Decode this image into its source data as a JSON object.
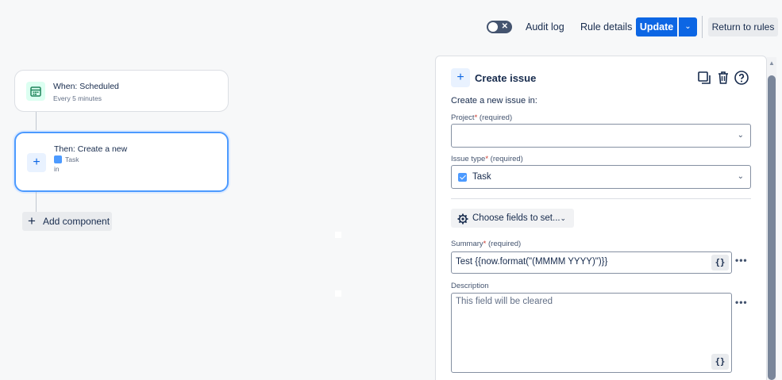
{
  "header": {
    "toggle_icon": "toggle-off-icon",
    "audit_log": "Audit log",
    "rule_details": "Rule details",
    "update": "Update",
    "return_to_rules": "Return to rules",
    "accent_color": "#0c66e4"
  },
  "canvas": {
    "trigger": {
      "icon": "calendar-icon",
      "title": "When: Scheduled",
      "subtitle": "Every 5 minutes"
    },
    "action": {
      "icon": "plus-icon",
      "title": "Then: Create a new",
      "issue_type": "Task",
      "suffix": "in"
    },
    "add_component": "Add component"
  },
  "panel": {
    "title": "Create issue",
    "actions": [
      "copy-icon",
      "trash-icon",
      "help-icon"
    ],
    "intro": "Create a new issue in:",
    "project": {
      "label": "Project",
      "required_mark": "*",
      "required_text": "(required)",
      "value": ""
    },
    "issue_type": {
      "label": "Issue type",
      "required_mark": "*",
      "required_text": "(required)",
      "value": "Task"
    },
    "choose_fields": "Choose fields to set...",
    "summary": {
      "label": "Summary",
      "required_mark": "*",
      "required_text": "(required)",
      "value": "Test {{now.format(\"(MMMM YYYY)\")}}",
      "smart_value": "{}"
    },
    "description": {
      "label": "Description",
      "placeholder": "This field will be cleared",
      "smart_value": "{}"
    }
  }
}
